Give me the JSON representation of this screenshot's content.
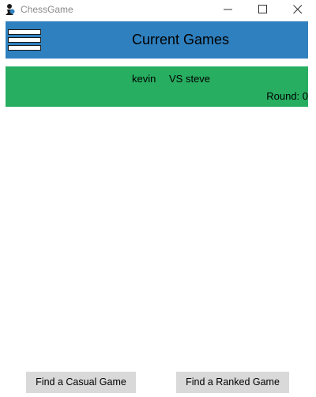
{
  "window": {
    "title": "ChessGame",
    "icons": [
      "chess-pawn-icon",
      "minimize-icon",
      "maximize-icon",
      "close-icon"
    ]
  },
  "header": {
    "title": "Current Games",
    "menu_icon": "hamburger-menu-icon",
    "color": "#2f80bf"
  },
  "games": [
    {
      "player_one": "kevin",
      "versus": "VS steve",
      "round": "Round: 0",
      "color": "#27ae60"
    }
  ],
  "actions": {
    "casual_label": "Find a Casual Game",
    "ranked_label": "Find a Ranked Game"
  }
}
